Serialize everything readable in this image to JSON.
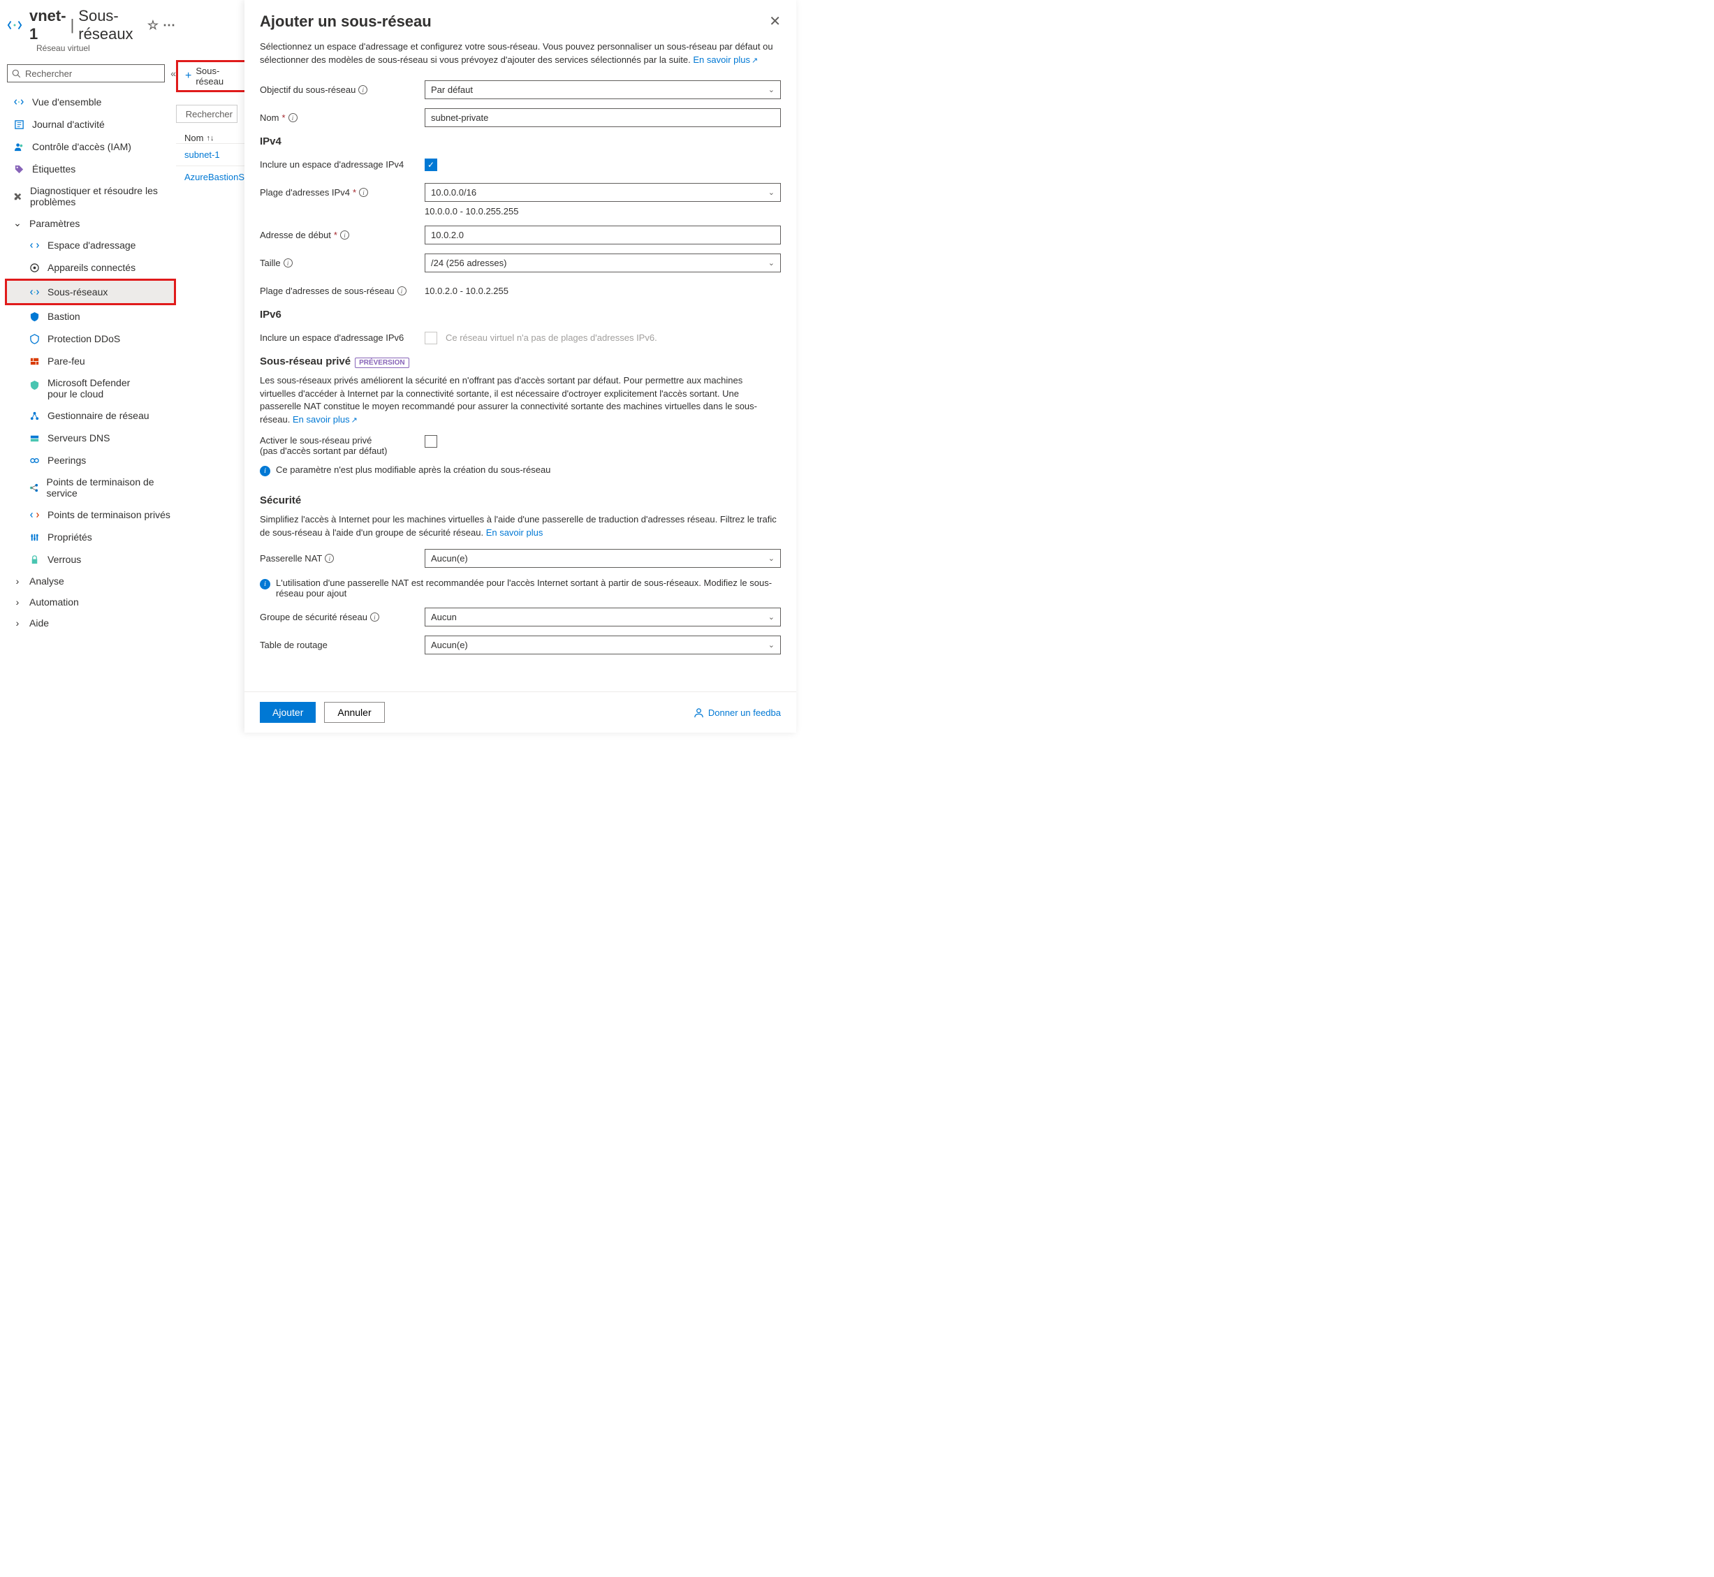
{
  "header": {
    "resource_name": "vnet-1",
    "section": "Sous-réseaux",
    "resource_type": "Réseau virtuel"
  },
  "left_search_placeholder": "Rechercher",
  "nav": {
    "overview": "Vue d'ensemble",
    "activity": "Journal d'activité",
    "iam": "Contrôle d'accès (IAM)",
    "tags": "Étiquettes",
    "diagnose": "Diagnostiquer et résoudre les problèmes",
    "settings": "Paramètres",
    "address_space": "Espace d'adressage",
    "devices": "Appareils connectés",
    "subnets": "Sous-réseaux",
    "bastion": "Bastion",
    "ddos": "Protection DDoS",
    "firewall": "Pare-feu",
    "defender1": "Microsoft Defender",
    "defender2": "pour le cloud",
    "netmgr": "Gestionnaire de réseau",
    "dns": "Serveurs DNS",
    "peerings": "Peerings",
    "svc_ep": "Points de terminaison de service",
    "priv_ep": "Points de terminaison privés",
    "props": "Propriétés",
    "locks": "Verrous",
    "analyse": "Analyse",
    "automation": "Automation",
    "help": "Aide"
  },
  "toolbar": {
    "add_subnet": "Sous-réseau"
  },
  "mid_search_placeholder": "Rechercher",
  "table": {
    "col_name": "Nom",
    "row1": "subnet-1",
    "row2": "AzureBastionS"
  },
  "panel": {
    "title": "Ajouter un sous-réseau",
    "intro": "Sélectionnez un espace d'adressage et configurez votre sous-réseau. Vous pouvez personnaliser un sous-réseau par défaut ou sélectionner des modèles de sous-réseau si vous prévoyez d'ajouter des services sélectionnés par la suite.",
    "learn_more": "En savoir plus",
    "purpose_label": "Objectif du sous-réseau",
    "purpose_value": "Par défaut",
    "name_label": "Nom",
    "name_value": "subnet-private",
    "ipv4_heading": "IPv4",
    "include_ipv4_label": "Inclure un espace d'adressage IPv4",
    "ipv4_range_label": "Plage d'adresses IPv4",
    "ipv4_range_value": "10.0.0.0/16",
    "ipv4_range_hint": "10.0.0.0 - 10.0.255.255",
    "start_label": "Adresse de début",
    "start_value": "10.0.2.0",
    "size_label": "Taille",
    "size_value": "/24 (256 adresses)",
    "subnet_range_label": "Plage d'adresses de sous-réseau",
    "subnet_range_value": "10.0.2.0 - 10.0.2.255",
    "ipv6_heading": "IPv6",
    "include_ipv6_label": "Inclure un espace d'adressage IPv6",
    "ipv6_disabled_msg": "Ce réseau virtuel n'a pas de plages d'adresses IPv6.",
    "private_heading": "Sous-réseau privé",
    "preview_badge": "PRÉVERSION",
    "private_desc": "Les sous-réseaux privés améliorent la sécurité en n'offrant pas d'accès sortant par défaut. Pour permettre aux machines virtuelles d'accéder à Internet par la connectivité sortante, il est nécessaire d'octroyer explicitement l'accès sortant. Une passerelle NAT constitue le moyen recommandé pour assurer la connectivité sortante des machines virtuelles dans le sous-réseau.",
    "enable_private_l1": "Activer le sous-réseau privé",
    "enable_private_l2": "(pas d'accès sortant par défaut)",
    "locked_msg": "Ce paramètre n'est plus modifiable après la création du sous-réseau",
    "security_heading": "Sécurité",
    "security_desc": "Simplifiez l'accès à Internet pour les machines virtuelles à l'aide d'une passerelle de traduction d'adresses réseau. Filtrez le trafic de sous-réseau à l'aide d'un groupe de sécurité réseau.",
    "nat_label": "Passerelle NAT",
    "nat_value": "Aucun(e)",
    "nat_info": "L'utilisation d'une passerelle NAT est recommandée pour l'accès Internet sortant à partir de sous-réseaux. Modifiez le sous-réseau pour ajout",
    "nsg_label": "Groupe de sécurité réseau",
    "nsg_value": "Aucun",
    "route_label": "Table de routage",
    "route_value": "Aucun(e)",
    "btn_add": "Ajouter",
    "btn_cancel": "Annuler",
    "feedback": "Donner un feedba"
  }
}
